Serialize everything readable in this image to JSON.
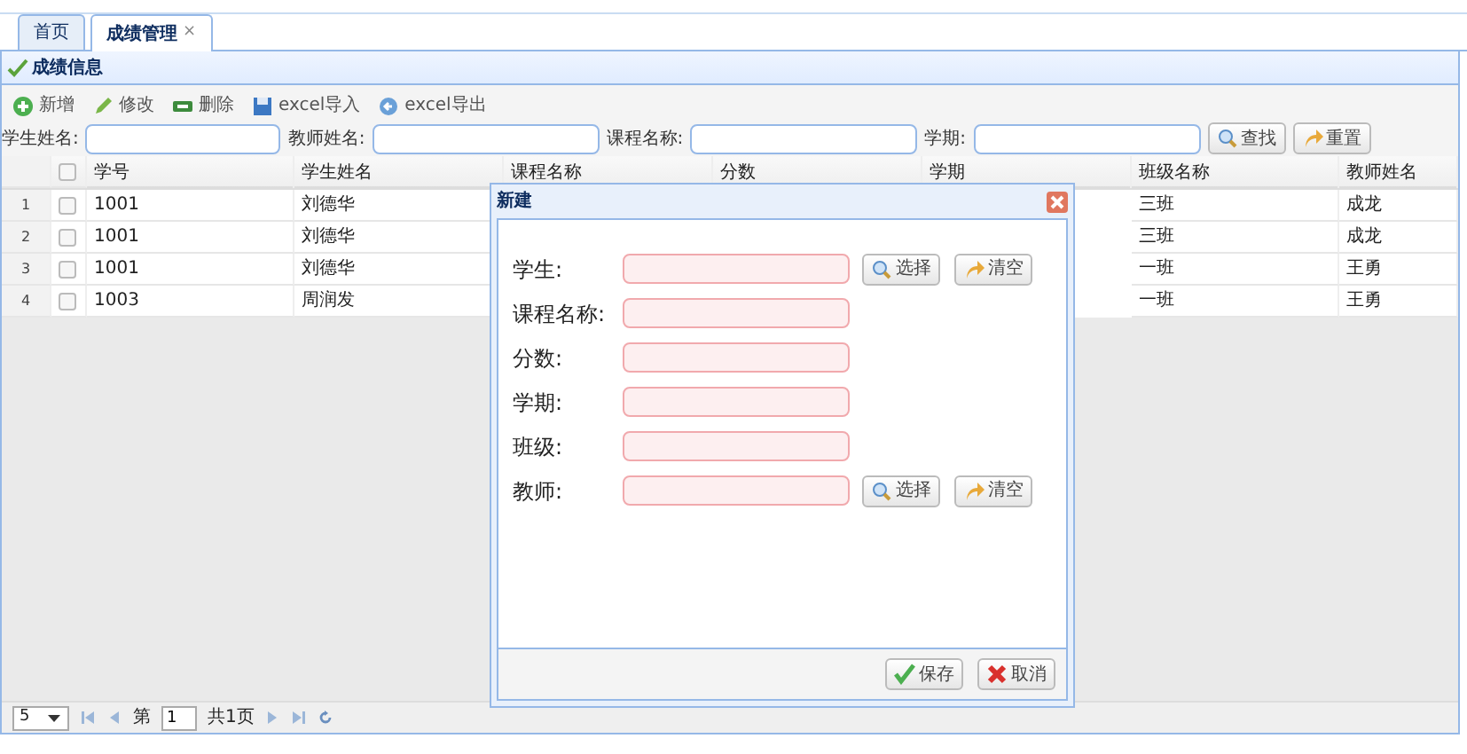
{
  "tabs": [
    {
      "label": "首页",
      "selected": false,
      "closable": false
    },
    {
      "label": "成绩管理",
      "selected": true,
      "closable": true,
      "close": "×"
    }
  ],
  "panel": {
    "title": "成绩信息"
  },
  "toolbar": [
    {
      "label": "新增",
      "kind": "add"
    },
    {
      "label": "修改",
      "kind": "edit"
    },
    {
      "label": "删除",
      "kind": "remove"
    },
    {
      "label": "excel导入",
      "kind": "import"
    },
    {
      "label": "excel导出",
      "kind": "export"
    }
  ],
  "search": {
    "fields": [
      {
        "label": "学生姓名:"
      },
      {
        "label": "教师姓名:"
      },
      {
        "label": "课程名称:"
      },
      {
        "label": "学期:"
      }
    ],
    "buttons": [
      {
        "label": "查找",
        "kind": "search"
      },
      {
        "label": "重置",
        "kind": "reset"
      }
    ]
  },
  "table": {
    "header_checked": false,
    "columns": [
      "学号",
      "学生姓名",
      "课程名称",
      "分数",
      "学期",
      "班级名称",
      "教师姓名"
    ],
    "rows": [
      {
        "number": "1",
        "checked": false,
        "cells": [
          "1001",
          "刘德华",
          "",
          "",
          "",
          "三班",
          "成龙"
        ]
      },
      {
        "number": "2",
        "checked": false,
        "cells": [
          "1001",
          "刘德华",
          "",
          "",
          "",
          "三班",
          "成龙"
        ]
      },
      {
        "number": "3",
        "checked": false,
        "cells": [
          "1001",
          "刘德华",
          "",
          "",
          "",
          "一班",
          "王勇"
        ]
      },
      {
        "number": "4",
        "checked": false,
        "cells": [
          "1003",
          "周润发",
          "",
          "",
          "",
          "一班",
          "王勇"
        ]
      }
    ]
  },
  "pager": {
    "page_size": "5",
    "page_prefix": "第",
    "page": "1",
    "page_total": "共1页"
  },
  "dialog": {
    "title": "新建",
    "fields": [
      {
        "label": "学生:",
        "select": "选择",
        "clear": "清空"
      },
      {
        "label": "课程名称:"
      },
      {
        "label": "分数:"
      },
      {
        "label": "学期:"
      },
      {
        "label": "班级:"
      },
      {
        "label": "教师:",
        "select": "选择",
        "clear": "清空"
      }
    ],
    "buttons": [
      {
        "label": "保存",
        "kind": "save"
      },
      {
        "label": "取消",
        "kind": "cancel"
      }
    ]
  }
}
